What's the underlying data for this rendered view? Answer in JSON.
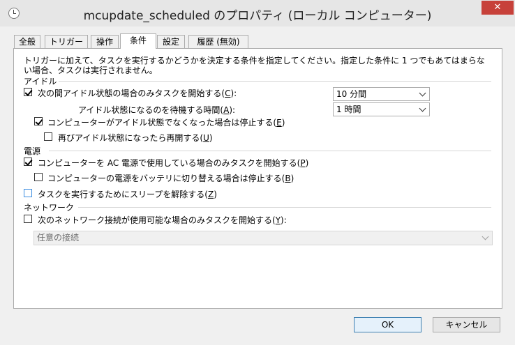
{
  "window": {
    "title": "mcupdate_scheduled のプロパティ (ローカル コンピューター)",
    "close_label": "✕"
  },
  "tabs": [
    {
      "label": "全般"
    },
    {
      "label": "トリガー"
    },
    {
      "label": "操作"
    },
    {
      "label": "条件",
      "active": true
    },
    {
      "label": "設定"
    },
    {
      "label": "履歴 (無効)"
    }
  ],
  "conditions": {
    "description": "トリガーに加えて、タスクを実行するかどうかを決定する条件を指定してください。指定した条件に 1 つでもあてはまらない場合、タスクは実行されません。",
    "idle": {
      "section_label": "アイドル",
      "start_if_idle": {
        "label_before": "次の間アイドル状態の場合のみタスクを開始する(",
        "key": "C",
        "label_after": "):",
        "checked": true
      },
      "idle_duration": "10 分間",
      "wait_label": {
        "before": "アイドル状態になるのを待機する時間(",
        "key": "A",
        "after": "):"
      },
      "wait_duration": "1 時間",
      "stop_if_not_idle": {
        "label_before": "コンピューターがアイドル状態でなくなった場合は停止する(",
        "key": "E",
        "label_after": ")",
        "checked": true
      },
      "restart_if_idle": {
        "label_before": "再びアイドル状態になったら再開する(",
        "key": "U",
        "label_after": ")",
        "checked": false
      }
    },
    "power": {
      "section_label": "電源",
      "start_on_ac": {
        "label_before": "コンピューターを AC 電源で使用している場合のみタスクを開始する(",
        "key": "P",
        "label_after": ")",
        "checked": true
      },
      "stop_on_battery": {
        "label_before": "コンピューターの電源をバッテリに切り替える場合は停止する(",
        "key": "B",
        "label_after": ")",
        "checked": false
      },
      "wake_to_run": {
        "label_before": "タスクを実行するためにスリープを解除する(",
        "key": "Z",
        "label_after": ")",
        "checked": false
      }
    },
    "network": {
      "section_label": "ネットワーク",
      "start_if_network": {
        "label_before": "次のネットワーク接続が使用可能な場合のみタスクを開始する(",
        "key": "Y",
        "label_after": "):",
        "checked": false
      },
      "connection": "任意の接続"
    }
  },
  "buttons": {
    "ok": "OK",
    "cancel": "キャンセル"
  }
}
